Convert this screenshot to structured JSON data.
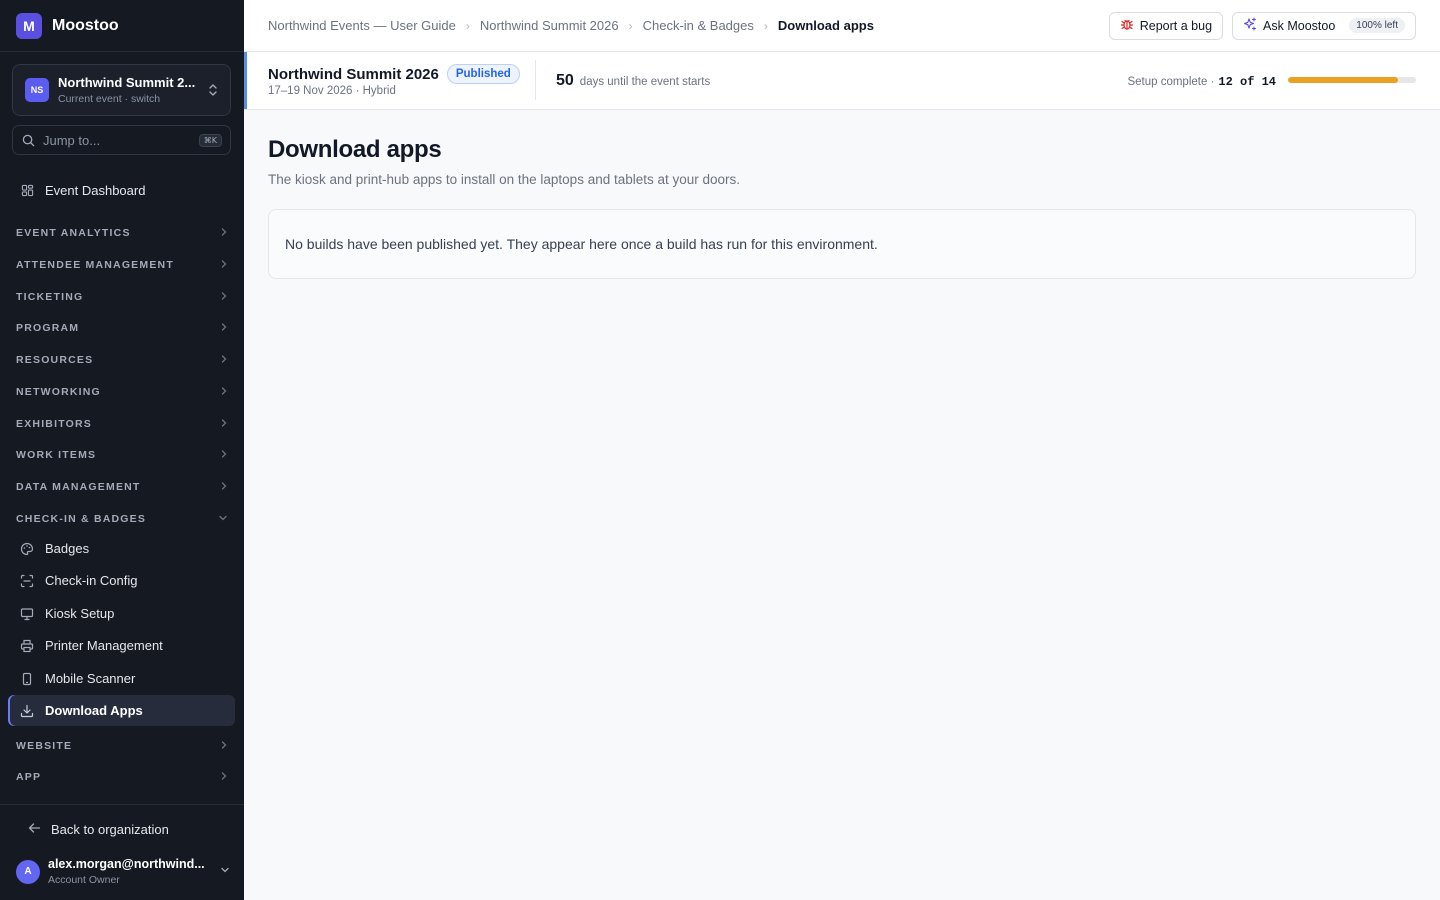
{
  "brand": {
    "logo_letter": "M",
    "name": "Moostoo"
  },
  "event_switcher": {
    "badge": "NS",
    "name": "Northwind Summit 2...",
    "subtitle": "Current event · switch"
  },
  "jump": {
    "placeholder": "Jump to...",
    "shortcut": "⌘K"
  },
  "sidebar": {
    "dashboard": {
      "label": "Event Dashboard",
      "icon": "dashboard-icon"
    },
    "sections": [
      "EVENT ANALYTICS",
      "ATTENDEE MANAGEMENT",
      "TICKETING",
      "PROGRAM",
      "RESOURCES",
      "NETWORKING",
      "EXHIBITORS",
      "WORK ITEMS",
      "DATA MANAGEMENT",
      "CHECK-IN & BADGES",
      "WEBSITE",
      "APP"
    ],
    "expanded_section": "CHECK-IN & BADGES",
    "checkin_items": [
      {
        "label": "Badges",
        "icon": "palette-icon"
      },
      {
        "label": "Check-in Config",
        "icon": "scan-icon"
      },
      {
        "label": "Kiosk Setup",
        "icon": "monitor-icon"
      },
      {
        "label": "Printer Management",
        "icon": "printer-icon"
      },
      {
        "label": "Mobile Scanner",
        "icon": "smartphone-icon"
      },
      {
        "label": "Download Apps",
        "icon": "download-icon",
        "active": true
      }
    ]
  },
  "footer": {
    "back_label": "Back to organization",
    "user_initial": "A",
    "user_email": "alex.morgan@northwind...",
    "user_role": "Account Owner"
  },
  "topbar": {
    "breadcrumbs": [
      "Northwind Events — User Guide",
      "Northwind Summit 2026",
      "Check-in & Badges",
      "Download apps"
    ],
    "report_bug_label": "Report a bug",
    "ask_label": "Ask Moostoo",
    "ask_quota": "100% left"
  },
  "eventbar": {
    "name": "Northwind Summit 2026",
    "status": "Published",
    "meta": "17–19 Nov 2026 · Hybrid",
    "days_count": "50",
    "days_label": "days until the event starts",
    "setup_label": "Setup complete ·",
    "setup_value": "12 of 14",
    "setup_done": 12,
    "setup_total": 14,
    "progress_color": "#eaa020"
  },
  "main": {
    "title": "Download apps",
    "subtitle": "The kiosk and print-hub apps to install on the laptops and tablets at your doors.",
    "empty_message": "No builds have been published yet. They appear here once a build has run for this environment."
  },
  "colors": {
    "sidebar_bg": "#151922",
    "accent": "#5b4fe0",
    "active_bar": "#6b7cf6"
  }
}
